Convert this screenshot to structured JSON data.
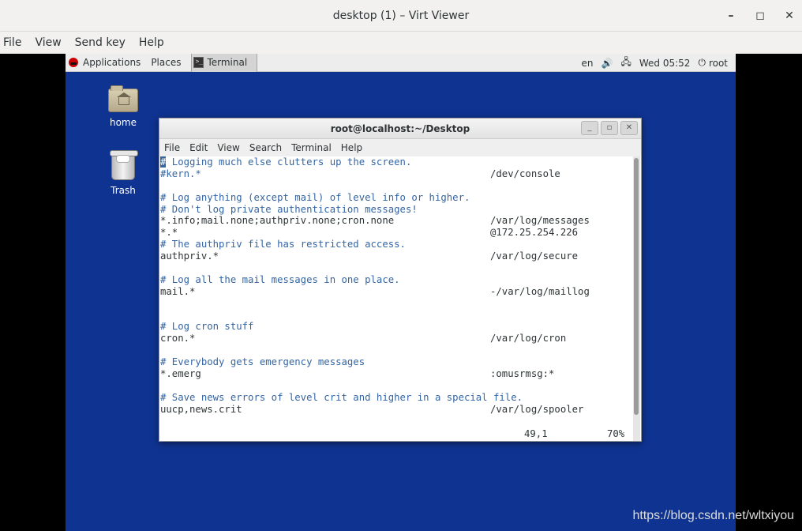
{
  "host": {
    "title": "desktop (1) – Virt Viewer",
    "menu": [
      "File",
      "View",
      "Send key",
      "Help"
    ],
    "controls": {
      "minimize": "–",
      "maximize": "◻",
      "close": "✕"
    }
  },
  "panel": {
    "applications": "Applications",
    "places": "Places",
    "task": "Terminal",
    "lang": "en",
    "datetime": "Wed 05:52",
    "user": "root"
  },
  "desktop": {
    "home_label": "home",
    "trash_label": "Trash"
  },
  "terminal": {
    "title": "root@localhost:~/Desktop",
    "menu": [
      "File",
      "Edit",
      "View",
      "Search",
      "Terminal",
      "Help"
    ],
    "lines": [
      {
        "c1": "# Logging much else clutters up the screen.",
        "c2": "",
        "comment": true,
        "cursor": true
      },
      {
        "c1": "#kern.*",
        "c2": "/dev/console",
        "comment": true
      },
      {
        "c1": "",
        "c2": ""
      },
      {
        "c1": "# Log anything (except mail) of level info or higher.",
        "c2": "",
        "comment": true
      },
      {
        "c1": "# Don't log private authentication messages!",
        "c2": "",
        "comment": true
      },
      {
        "c1": "*.info;mail.none;authpriv.none;cron.none",
        "c2": "/var/log/messages"
      },
      {
        "c1": "*.*",
        "c2": "@172.25.254.226"
      },
      {
        "c1": "# The authpriv file has restricted access.",
        "c2": "",
        "comment": true
      },
      {
        "c1": "authpriv.*",
        "c2": "/var/log/secure"
      },
      {
        "c1": "",
        "c2": ""
      },
      {
        "c1": "# Log all the mail messages in one place.",
        "c2": "",
        "comment": true
      },
      {
        "c1": "mail.*",
        "c2": "-/var/log/maillog"
      },
      {
        "c1": "",
        "c2": ""
      },
      {
        "c1": "",
        "c2": ""
      },
      {
        "c1": "# Log cron stuff",
        "c2": "",
        "comment": true
      },
      {
        "c1": "cron.*",
        "c2": "/var/log/cron"
      },
      {
        "c1": "",
        "c2": ""
      },
      {
        "c1": "# Everybody gets emergency messages",
        "c2": "",
        "comment": true
      },
      {
        "c1": "*.emerg",
        "c2": ":omusrmsg:*"
      },
      {
        "c1": "",
        "c2": ""
      },
      {
        "c1": "# Save news errors of level crit and higher in a special file.",
        "c2": "",
        "comment": true
      },
      {
        "c1": "uucp,news.crit",
        "c2": "/var/log/spooler"
      }
    ],
    "status_position": "49,1",
    "status_percent": "70%"
  },
  "watermark": "https://blog.csdn.net/wltxiyou",
  "colors": {
    "desktop": "#0f3391",
    "comment": "#3465a4"
  }
}
